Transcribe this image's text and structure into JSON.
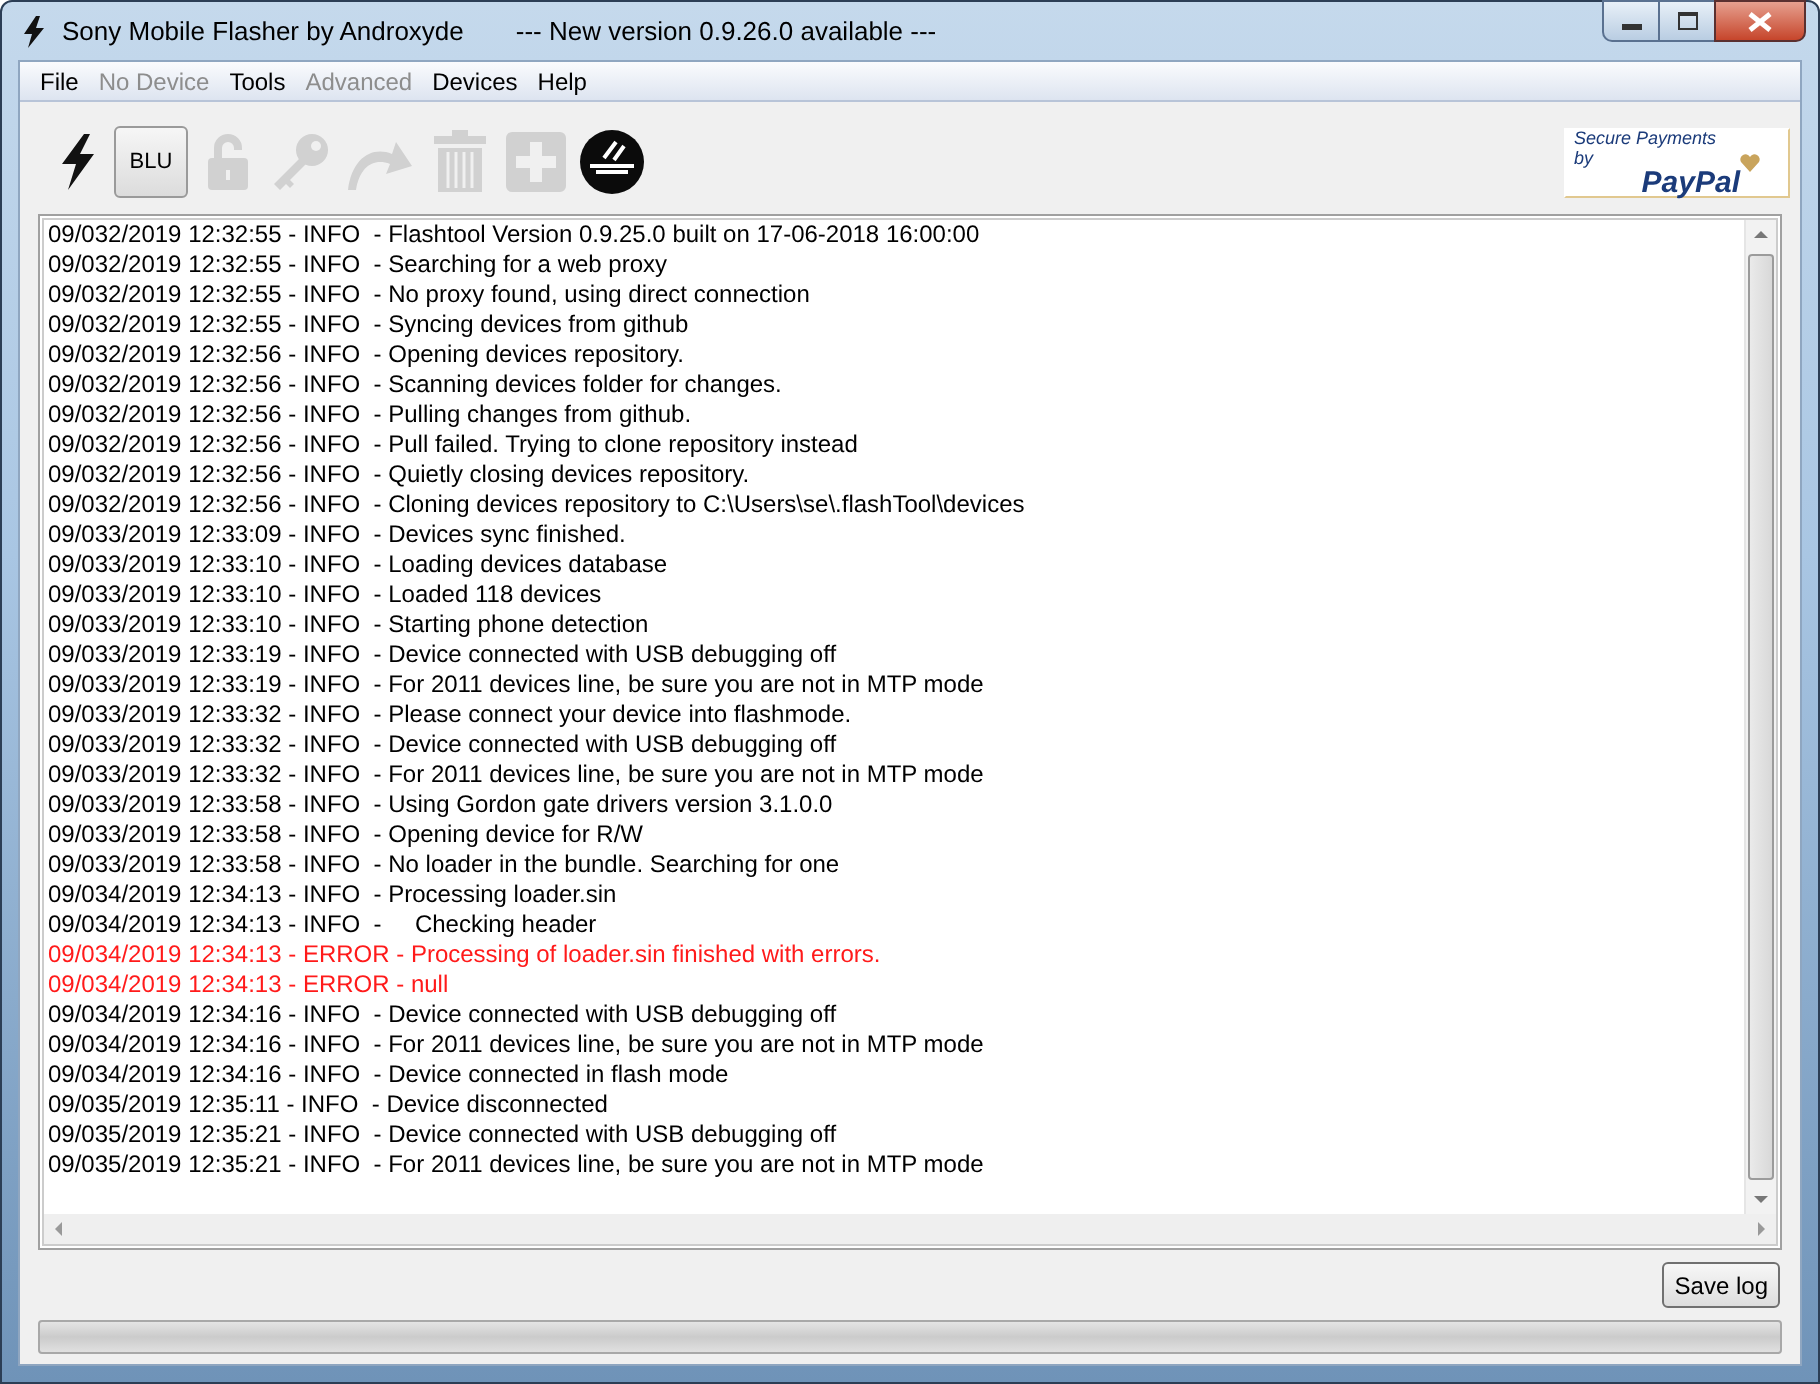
{
  "window": {
    "title": "Sony Mobile Flasher by Androxyde",
    "notice": "--- New version 0.9.26.0 available ---"
  },
  "menu": [
    {
      "label": "File",
      "disabled": false
    },
    {
      "label": "No Device",
      "disabled": true
    },
    {
      "label": "Tools",
      "disabled": false
    },
    {
      "label": "Advanced",
      "disabled": true
    },
    {
      "label": "Devices",
      "disabled": false
    },
    {
      "label": "Help",
      "disabled": false
    }
  ],
  "toolbar": [
    {
      "kind": "bolt",
      "disabled": false
    },
    {
      "kind": "text",
      "label": "BLU",
      "disabled": false
    },
    {
      "kind": "lock",
      "disabled": true
    },
    {
      "kind": "key",
      "disabled": true
    },
    {
      "kind": "redo",
      "disabled": true
    },
    {
      "kind": "trash",
      "disabled": true
    },
    {
      "kind": "plus",
      "disabled": true
    },
    {
      "kind": "xf",
      "disabled": false
    }
  ],
  "paypal": {
    "line1": "Secure Payments by",
    "line2": "PayPal"
  },
  "log": [
    {
      "kind": "info",
      "text": "09/032/2019 12:32:55 - INFO  - Flashtool Version 0.9.25.0 built on 17-06-2018 16:00:00"
    },
    {
      "kind": "info",
      "text": "09/032/2019 12:32:55 - INFO  - Searching for a web proxy"
    },
    {
      "kind": "info",
      "text": "09/032/2019 12:32:55 - INFO  - No proxy found, using direct connection"
    },
    {
      "kind": "info",
      "text": "09/032/2019 12:32:55 - INFO  - Syncing devices from github"
    },
    {
      "kind": "info",
      "text": "09/032/2019 12:32:56 - INFO  - Opening devices repository."
    },
    {
      "kind": "info",
      "text": "09/032/2019 12:32:56 - INFO  - Scanning devices folder for changes."
    },
    {
      "kind": "info",
      "text": "09/032/2019 12:32:56 - INFO  - Pulling changes from github."
    },
    {
      "kind": "info",
      "text": "09/032/2019 12:32:56 - INFO  - Pull failed. Trying to clone repository instead"
    },
    {
      "kind": "info",
      "text": "09/032/2019 12:32:56 - INFO  - Quietly closing devices repository."
    },
    {
      "kind": "info",
      "text": "09/032/2019 12:32:56 - INFO  - Cloning devices repository to C:\\Users\\se\\.flashTool\\devices"
    },
    {
      "kind": "info",
      "text": "09/033/2019 12:33:09 - INFO  - Devices sync finished."
    },
    {
      "kind": "info",
      "text": "09/033/2019 12:33:10 - INFO  - Loading devices database"
    },
    {
      "kind": "info",
      "text": "09/033/2019 12:33:10 - INFO  - Loaded 118 devices"
    },
    {
      "kind": "info",
      "text": "09/033/2019 12:33:10 - INFO  - Starting phone detection"
    },
    {
      "kind": "info",
      "text": "09/033/2019 12:33:19 - INFO  - Device connected with USB debugging off"
    },
    {
      "kind": "info",
      "text": "09/033/2019 12:33:19 - INFO  - For 2011 devices line, be sure you are not in MTP mode"
    },
    {
      "kind": "info",
      "text": "09/033/2019 12:33:32 - INFO  - Please connect your device into flashmode."
    },
    {
      "kind": "info",
      "text": "09/033/2019 12:33:32 - INFO  - Device connected with USB debugging off"
    },
    {
      "kind": "info",
      "text": "09/033/2019 12:33:32 - INFO  - For 2011 devices line, be sure you are not in MTP mode"
    },
    {
      "kind": "info",
      "text": "09/033/2019 12:33:58 - INFO  - Using Gordon gate drivers version 3.1.0.0"
    },
    {
      "kind": "info",
      "text": "09/033/2019 12:33:58 - INFO  - Opening device for R/W"
    },
    {
      "kind": "info",
      "text": "09/033/2019 12:33:58 - INFO  - No loader in the bundle. Searching for one"
    },
    {
      "kind": "info",
      "text": "09/034/2019 12:34:13 - INFO  - Processing loader.sin"
    },
    {
      "kind": "info",
      "text": "09/034/2019 12:34:13 - INFO  -     Checking header"
    },
    {
      "kind": "error",
      "text": "09/034/2019 12:34:13 - ERROR - Processing of loader.sin finished with errors."
    },
    {
      "kind": "error",
      "text": "09/034/2019 12:34:13 - ERROR - null"
    },
    {
      "kind": "info",
      "text": "09/034/2019 12:34:16 - INFO  - Device connected with USB debugging off"
    },
    {
      "kind": "info",
      "text": "09/034/2019 12:34:16 - INFO  - For 2011 devices line, be sure you are not in MTP mode"
    },
    {
      "kind": "info",
      "text": "09/034/2019 12:34:16 - INFO  - Device connected in flash mode"
    },
    {
      "kind": "info",
      "text": "09/035/2019 12:35:11 - INFO  - Device disconnected"
    },
    {
      "kind": "info",
      "text": "09/035/2019 12:35:21 - INFO  - Device connected with USB debugging off"
    },
    {
      "kind": "info",
      "text": "09/035/2019 12:35:21 - INFO  - For 2011 devices line, be sure you are not in MTP mode"
    }
  ],
  "save_button": "Save log",
  "progress": {
    "level": 0
  }
}
